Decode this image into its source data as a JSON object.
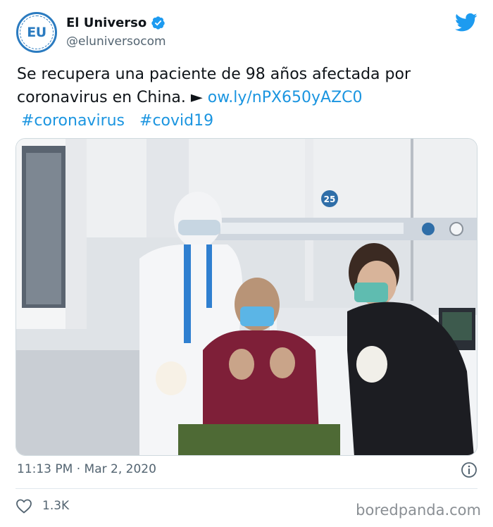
{
  "account": {
    "avatar_text": "EU",
    "display_name": "El Universo",
    "handle": "@eluniversocom",
    "verified_icon": "verified-badge-icon",
    "platform_icon": "twitter-bird-icon",
    "brand_color": "#2b7bc0"
  },
  "tweet": {
    "text": "Se recupera una paciente de 98 años afectada por coronavirus en China. ►",
    "link_text": "ow.ly/nPX650yAZC0",
    "hashtags": [
      "#coronavirus",
      "#covid19"
    ],
    "link_color": "#1b95e0"
  },
  "photo": {
    "room_number": "25"
  },
  "meta": {
    "timestamp": "11:13 PM · Mar 2, 2020",
    "info_icon": "info-icon"
  },
  "engagement": {
    "like_icon": "heart-icon",
    "like_count": "1.3K"
  },
  "watermark": "boredpanda.com"
}
